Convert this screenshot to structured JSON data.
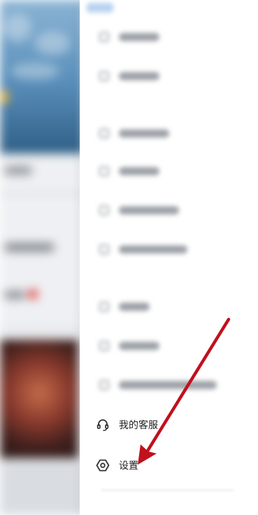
{
  "drawer": {
    "menu_items": [
      {
        "label": "我的客服",
        "icon": "headset-icon"
      },
      {
        "label": "设置",
        "icon": "gear-hexagon-icon"
      }
    ]
  },
  "annotation": {
    "color": "#c0111d",
    "target": "settings"
  },
  "colors": {
    "text": "#222222",
    "icon": "#333333"
  }
}
